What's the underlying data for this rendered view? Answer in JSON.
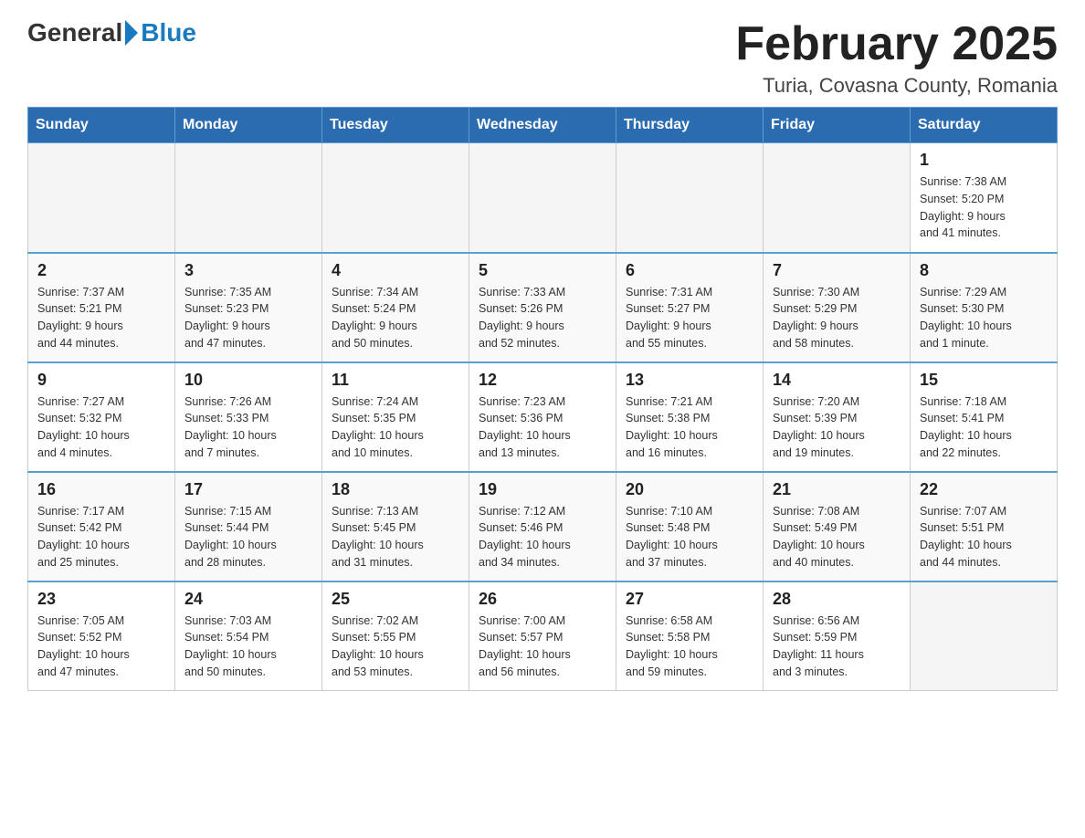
{
  "header": {
    "logo_general": "General",
    "logo_blue": "Blue",
    "month_title": "February 2025",
    "location": "Turia, Covasna County, Romania"
  },
  "days_of_week": [
    "Sunday",
    "Monday",
    "Tuesday",
    "Wednesday",
    "Thursday",
    "Friday",
    "Saturday"
  ],
  "weeks": [
    [
      {
        "day": "",
        "info": ""
      },
      {
        "day": "",
        "info": ""
      },
      {
        "day": "",
        "info": ""
      },
      {
        "day": "",
        "info": ""
      },
      {
        "day": "",
        "info": ""
      },
      {
        "day": "",
        "info": ""
      },
      {
        "day": "1",
        "info": "Sunrise: 7:38 AM\nSunset: 5:20 PM\nDaylight: 9 hours\nand 41 minutes."
      }
    ],
    [
      {
        "day": "2",
        "info": "Sunrise: 7:37 AM\nSunset: 5:21 PM\nDaylight: 9 hours\nand 44 minutes."
      },
      {
        "day": "3",
        "info": "Sunrise: 7:35 AM\nSunset: 5:23 PM\nDaylight: 9 hours\nand 47 minutes."
      },
      {
        "day": "4",
        "info": "Sunrise: 7:34 AM\nSunset: 5:24 PM\nDaylight: 9 hours\nand 50 minutes."
      },
      {
        "day": "5",
        "info": "Sunrise: 7:33 AM\nSunset: 5:26 PM\nDaylight: 9 hours\nand 52 minutes."
      },
      {
        "day": "6",
        "info": "Sunrise: 7:31 AM\nSunset: 5:27 PM\nDaylight: 9 hours\nand 55 minutes."
      },
      {
        "day": "7",
        "info": "Sunrise: 7:30 AM\nSunset: 5:29 PM\nDaylight: 9 hours\nand 58 minutes."
      },
      {
        "day": "8",
        "info": "Sunrise: 7:29 AM\nSunset: 5:30 PM\nDaylight: 10 hours\nand 1 minute."
      }
    ],
    [
      {
        "day": "9",
        "info": "Sunrise: 7:27 AM\nSunset: 5:32 PM\nDaylight: 10 hours\nand 4 minutes."
      },
      {
        "day": "10",
        "info": "Sunrise: 7:26 AM\nSunset: 5:33 PM\nDaylight: 10 hours\nand 7 minutes."
      },
      {
        "day": "11",
        "info": "Sunrise: 7:24 AM\nSunset: 5:35 PM\nDaylight: 10 hours\nand 10 minutes."
      },
      {
        "day": "12",
        "info": "Sunrise: 7:23 AM\nSunset: 5:36 PM\nDaylight: 10 hours\nand 13 minutes."
      },
      {
        "day": "13",
        "info": "Sunrise: 7:21 AM\nSunset: 5:38 PM\nDaylight: 10 hours\nand 16 minutes."
      },
      {
        "day": "14",
        "info": "Sunrise: 7:20 AM\nSunset: 5:39 PM\nDaylight: 10 hours\nand 19 minutes."
      },
      {
        "day": "15",
        "info": "Sunrise: 7:18 AM\nSunset: 5:41 PM\nDaylight: 10 hours\nand 22 minutes."
      }
    ],
    [
      {
        "day": "16",
        "info": "Sunrise: 7:17 AM\nSunset: 5:42 PM\nDaylight: 10 hours\nand 25 minutes."
      },
      {
        "day": "17",
        "info": "Sunrise: 7:15 AM\nSunset: 5:44 PM\nDaylight: 10 hours\nand 28 minutes."
      },
      {
        "day": "18",
        "info": "Sunrise: 7:13 AM\nSunset: 5:45 PM\nDaylight: 10 hours\nand 31 minutes."
      },
      {
        "day": "19",
        "info": "Sunrise: 7:12 AM\nSunset: 5:46 PM\nDaylight: 10 hours\nand 34 minutes."
      },
      {
        "day": "20",
        "info": "Sunrise: 7:10 AM\nSunset: 5:48 PM\nDaylight: 10 hours\nand 37 minutes."
      },
      {
        "day": "21",
        "info": "Sunrise: 7:08 AM\nSunset: 5:49 PM\nDaylight: 10 hours\nand 40 minutes."
      },
      {
        "day": "22",
        "info": "Sunrise: 7:07 AM\nSunset: 5:51 PM\nDaylight: 10 hours\nand 44 minutes."
      }
    ],
    [
      {
        "day": "23",
        "info": "Sunrise: 7:05 AM\nSunset: 5:52 PM\nDaylight: 10 hours\nand 47 minutes."
      },
      {
        "day": "24",
        "info": "Sunrise: 7:03 AM\nSunset: 5:54 PM\nDaylight: 10 hours\nand 50 minutes."
      },
      {
        "day": "25",
        "info": "Sunrise: 7:02 AM\nSunset: 5:55 PM\nDaylight: 10 hours\nand 53 minutes."
      },
      {
        "day": "26",
        "info": "Sunrise: 7:00 AM\nSunset: 5:57 PM\nDaylight: 10 hours\nand 56 minutes."
      },
      {
        "day": "27",
        "info": "Sunrise: 6:58 AM\nSunset: 5:58 PM\nDaylight: 10 hours\nand 59 minutes."
      },
      {
        "day": "28",
        "info": "Sunrise: 6:56 AM\nSunset: 5:59 PM\nDaylight: 11 hours\nand 3 minutes."
      },
      {
        "day": "",
        "info": ""
      }
    ]
  ]
}
